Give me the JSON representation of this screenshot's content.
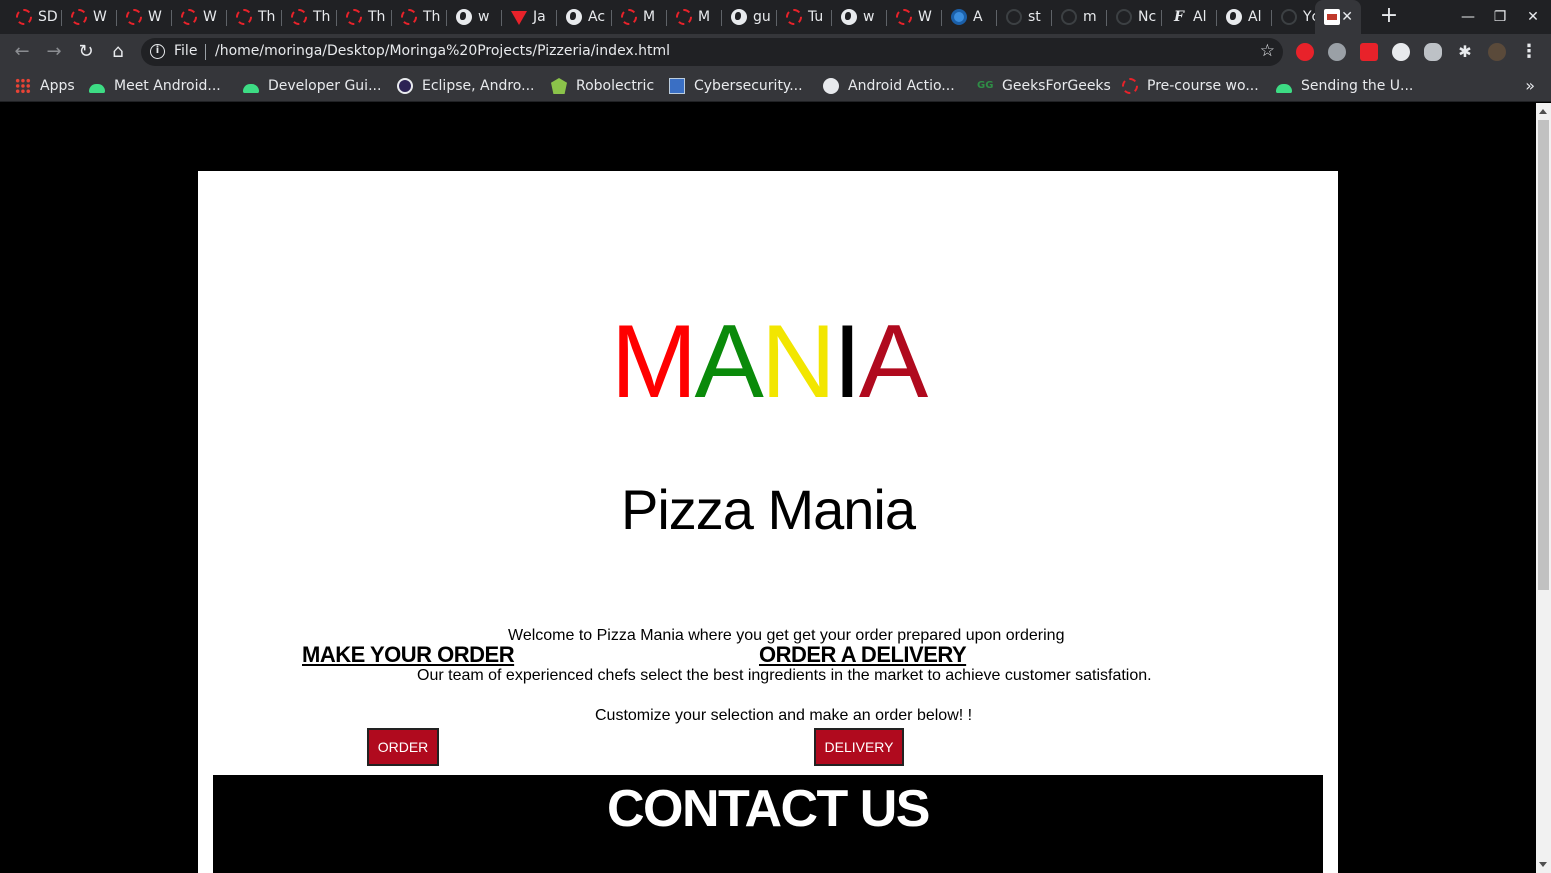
{
  "browser": {
    "tabs": [
      {
        "label": "SD",
        "icon": "dashed-circle-icon"
      },
      {
        "label": "W",
        "icon": "dashed-circle-icon"
      },
      {
        "label": "W",
        "icon": "dashed-circle-icon"
      },
      {
        "label": "W",
        "icon": "dashed-circle-icon"
      },
      {
        "label": "Th",
        "icon": "dashed-circle-icon"
      },
      {
        "label": "Th",
        "icon": "dashed-circle-icon"
      },
      {
        "label": "Th",
        "icon": "dashed-circle-icon"
      },
      {
        "label": "Th",
        "icon": "dashed-circle-icon"
      },
      {
        "label": "w",
        "icon": "globe-icon"
      },
      {
        "label": "Ja",
        "icon": "v-triangle-icon"
      },
      {
        "label": "Ac",
        "icon": "globe-icon"
      },
      {
        "label": "M",
        "icon": "dashed-circle-icon"
      },
      {
        "label": "M",
        "icon": "dashed-circle-icon"
      },
      {
        "label": "gu",
        "icon": "globe-icon"
      },
      {
        "label": "Tu",
        "icon": "dashed-circle-icon"
      },
      {
        "label": "w",
        "icon": "globe-icon"
      },
      {
        "label": "W",
        "icon": "dashed-circle-icon"
      },
      {
        "label": "A",
        "icon": "blue-ball-icon"
      },
      {
        "label": "st",
        "icon": "github-icon"
      },
      {
        "label": "m",
        "icon": "github-icon"
      },
      {
        "label": "Nc",
        "icon": "github-icon"
      },
      {
        "label": "Al",
        "icon": "f-script-icon"
      },
      {
        "label": "Al",
        "icon": "globe-icon"
      },
      {
        "label": "Yc",
        "icon": "github-icon"
      }
    ],
    "active_tab_close": "✕",
    "new_tab": "+",
    "window_controls": {
      "minimize": "—",
      "restore": "❐",
      "close": "✕"
    },
    "nav": {
      "back": "←",
      "forward": "→",
      "reload": "↻",
      "home": "⌂"
    },
    "omnibox": {
      "scheme_label": "File",
      "url": "/home/moringa/Desktop/Moringa%20Projects/Pizzeria/index.html",
      "star": "☆"
    },
    "bookmarks": [
      {
        "label": "Apps",
        "icon": "apps-grid-icon"
      },
      {
        "label": "Meet Android...",
        "icon": "android-icon"
      },
      {
        "label": "Developer Gui...",
        "icon": "android-icon"
      },
      {
        "label": "Eclipse, Andro...",
        "icon": "eclipse-icon"
      },
      {
        "label": "Robolectric",
        "icon": "robolectric-icon"
      },
      {
        "label": "Cybersecurity...",
        "icon": "cybersecurity-icon"
      },
      {
        "label": "Android Actio...",
        "icon": "globe-icon"
      },
      {
        "label": "GeeksForGeeks",
        "icon": "gfg-icon"
      },
      {
        "label": "Pre-course wo...",
        "icon": "dashed-circle-icon"
      },
      {
        "label": "Sending the U...",
        "icon": "android-icon"
      }
    ],
    "bookmarks_more": "»",
    "extension_menu": "⋮"
  },
  "page": {
    "logo_letters": [
      {
        "char": "M",
        "color": "#ff0000"
      },
      {
        "char": "A",
        "color": "#0a8a0a"
      },
      {
        "char": "N",
        "color": "#f2e600"
      },
      {
        "char": "I",
        "color": "#000000"
      },
      {
        "char": "A",
        "color": "#b00a1e"
      }
    ],
    "title": "Pizza Mania",
    "welcome_text": "Welcome to Pizza Mania where you get get your order prepared upon ordering",
    "team_text": "Our team of experienced chefs select the best ingredients in the market to achieve customer satisfation.",
    "customize_text": "Customize your selection and make an order below! !",
    "make_order_heading": "MAKE YOUR ORDER",
    "order_button": "ORDER",
    "delivery_heading": "ORDER A DELIVERY",
    "delivery_button": "DELIVERY",
    "contact_heading": "CONTACT US"
  },
  "colors": {
    "accent_red": "#b00a1e",
    "browser_dark": "#202124",
    "toolbar": "#35363a"
  }
}
